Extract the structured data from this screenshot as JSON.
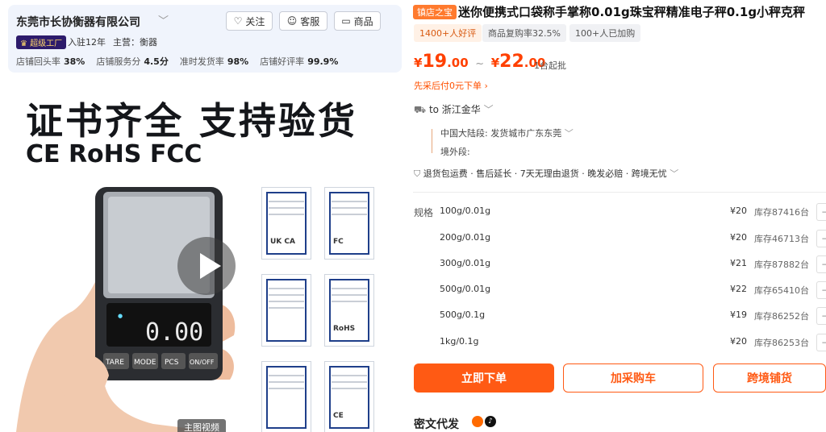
{
  "shop": {
    "name": "东莞市长协衡器有限公司",
    "follow_label": "关注",
    "service_label": "客服",
    "goods_label": "商品",
    "factory_badge": "超级工厂",
    "years": "入驻12年",
    "main_business": "主营：衡器",
    "stats": [
      {
        "label": "店铺回头率",
        "value": "38%"
      },
      {
        "label": "店铺服务分",
        "value": "4.5分"
      },
      {
        "label": "准时发货率",
        "value": "98%"
      },
      {
        "label": "店铺好评率",
        "value": "99.9%"
      }
    ]
  },
  "gallery": {
    "headline": "证书齐全 支持验货",
    "subline": "CE RoHS FCC",
    "scale_display": "0.00",
    "scale_buttons": [
      "TARE",
      "MODE",
      "PCS",
      "ON/OFF"
    ],
    "video_label": "主图视频",
    "cert_logos": [
      "UK CA",
      "FC",
      "",
      "RoHS",
      "",
      "CE"
    ]
  },
  "product": {
    "store_tag": "镇店之宝",
    "title": "迷你便携式口袋称手掌称0.01g珠宝秤精准电子秤0.1g小秤克秤",
    "tags": [
      "1400+人好评",
      "商品复购率32.5%",
      "100+人已加购"
    ],
    "price_low": "19",
    "price_low_dec": ".00",
    "price_high": "22",
    "price_high_dec": ".00",
    "currency": "¥",
    "price_sep": "~",
    "min_order": "1台起批",
    "pay_later": "先采后付0元下单",
    "ship_to": "to 浙江金华",
    "mainland_label": "中国大陆段:",
    "mainland_value": "发货城市广东东莞",
    "overseas_label": "境外段:",
    "guarantees": "退货包运费 · 售后延长 · 7天无理由退货 · 晚发必赔 · 跨境无忧",
    "spec_label": "规格",
    "specs": [
      {
        "name": "100g/0.01g",
        "price": "¥20",
        "stock": "库存87416台"
      },
      {
        "name": "200g/0.01g",
        "price": "¥20",
        "stock": "库存46713台"
      },
      {
        "name": "300g/0.01g",
        "price": "¥21",
        "stock": "库存87882台"
      },
      {
        "name": "500g/0.01g",
        "price": "¥22",
        "stock": "库存65410台"
      },
      {
        "name": "500g/0.1g",
        "price": "¥19",
        "stock": "库存86252台"
      },
      {
        "name": "1kg/0.1g",
        "price": "¥20",
        "stock": "库存86253台"
      }
    ],
    "qty_minus": "−",
    "buy_label": "立即下单",
    "cart_label": "加采购车",
    "cross_label": "跨境铺货",
    "secret_label": "密文代发"
  },
  "colors": {
    "accent": "#ff5a14",
    "price": "#ff4000",
    "badge_bg": "#2d1b6b"
  }
}
